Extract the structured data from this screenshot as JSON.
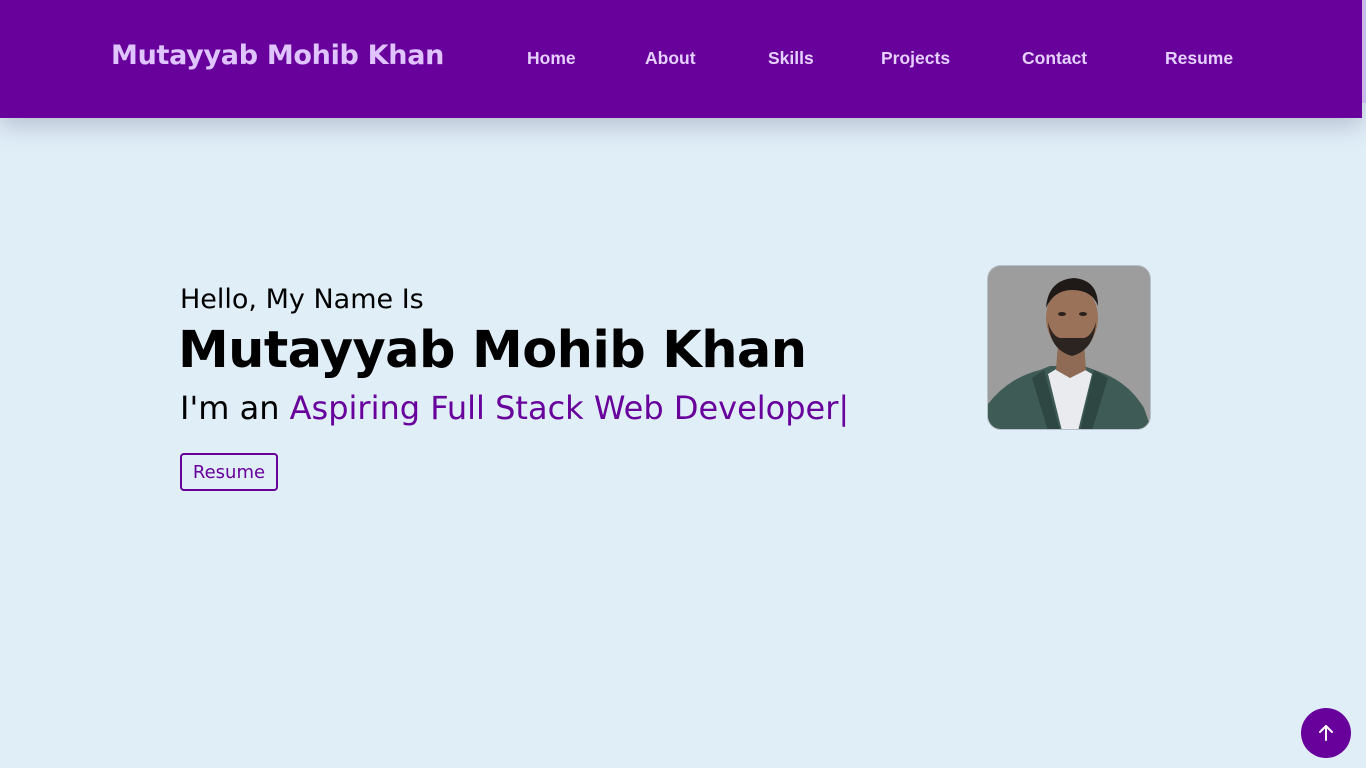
{
  "navbar": {
    "brand": "Mutayyab Mohib Khan",
    "links": [
      {
        "label": "Home"
      },
      {
        "label": "About"
      },
      {
        "label": "Skills"
      },
      {
        "label": "Projects"
      },
      {
        "label": "Contact"
      },
      {
        "label": "Resume"
      }
    ]
  },
  "hero": {
    "greeting": "Hello, My Name Is",
    "name": "Mutayyab Mohib Khan",
    "tagline_prefix": "I'm an ",
    "tagline_role": "Aspiring Full Stack Web Developer|",
    "resume_button": "Resume"
  },
  "icons": {
    "scroll_top": "arrow-up-icon",
    "avatar": "profile-photo"
  },
  "colors": {
    "brand_purple": "#68009b",
    "nav_text": "#e6d0ff",
    "page_background": "#e0eef8"
  }
}
